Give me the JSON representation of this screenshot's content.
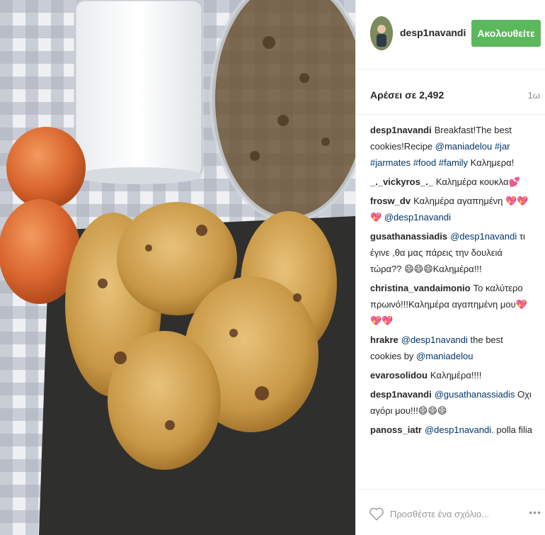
{
  "post": {
    "photo_alt": "oatmeal cookies, glass of milk, eggs",
    "author": {
      "username": "desp1navandi",
      "avatar_icon": "avatar-photo"
    },
    "follow_label": "Ακολουθείτε",
    "likes_label": "Αρέσει σε 2,492",
    "time_ago": "1ω"
  },
  "comments": [
    {
      "user": "desp1navandi",
      "parts": [
        {
          "t": "Breakfast!The best cookies!Recipe "
        },
        {
          "t": "@maniadelou",
          "link": true
        },
        {
          "t": " "
        },
        {
          "t": "#jar",
          "link": true
        },
        {
          "t": " "
        },
        {
          "t": "#jarmates",
          "link": true
        },
        {
          "t": " "
        },
        {
          "t": "#food",
          "link": true
        },
        {
          "t": " "
        },
        {
          "t": "#family",
          "link": true
        },
        {
          "t": " Καλημερα!"
        }
      ]
    },
    {
      "user": "_._vickyros_._",
      "parts": [
        {
          "t": "Καλημέρα κουκλα💕"
        }
      ]
    },
    {
      "user": "frosw_dv",
      "parts": [
        {
          "t": "Καλημέρα αγαπημένη 💖💖💖 "
        },
        {
          "t": "@desp1navandi",
          "link": true
        }
      ]
    },
    {
      "user": "gusathanassiadis",
      "parts": [
        {
          "t": "@desp1navandi",
          "link": true
        },
        {
          "t": " τι έγινε ,θα μας πάρεις την δουλειά τώρα?? 😄😄😄Καλημέρα!!!"
        }
      ]
    },
    {
      "user": "christina_vandaimonio",
      "parts": [
        {
          "t": "Το καλύτερο πρωινό!!!Καλημέρα αγαπημένη μου💖💖💖"
        }
      ]
    },
    {
      "user": "hrakre",
      "parts": [
        {
          "t": "@desp1navandi",
          "link": true
        },
        {
          "t": " the best cookies by "
        },
        {
          "t": "@maniadelou",
          "link": true
        }
      ]
    },
    {
      "user": "evarosolidou",
      "parts": [
        {
          "t": "Καλημέρα!!!!"
        }
      ]
    },
    {
      "user": "desp1navandi",
      "parts": [
        {
          "t": "@gusathanassiadis",
          "link": true
        },
        {
          "t": " Οχι αγόρι μου!!!😄😄😄"
        }
      ]
    },
    {
      "user": "panoss_iatr",
      "parts": [
        {
          "t": "@desp1navandi",
          "link": true
        },
        {
          "t": ". polla filia"
        }
      ]
    }
  ],
  "footer": {
    "like_icon": "heart-outline-icon",
    "comment_placeholder": "Προσθέστε ένα σχόλιο...",
    "more_label": "•••"
  },
  "colors": {
    "follow_button": "#5cb85c",
    "link": "#003569",
    "divider": "#efefef",
    "muted": "#8a8a8a"
  }
}
